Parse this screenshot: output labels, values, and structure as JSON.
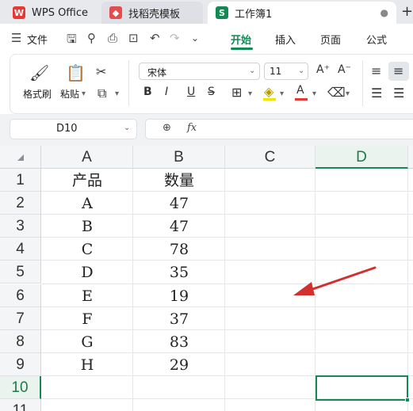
{
  "tabs": {
    "app": "WPS Office",
    "templates": "找稻壳模板",
    "workbook": "工作簿1",
    "workbook_badge": "S",
    "new_tab": "+"
  },
  "menu": {
    "file": "文件",
    "home": "开始",
    "insert": "插入",
    "page": "页面",
    "formula": "公式"
  },
  "ribbon": {
    "format_painter": "格式刷",
    "paste": "粘贴",
    "font_name": "宋体",
    "font_size": "11"
  },
  "formula_bar": {
    "name_box": "D10",
    "fx_label": "fx",
    "content": ""
  },
  "grid": {
    "columns": [
      "A",
      "B",
      "C",
      "D"
    ],
    "rows": [
      "1",
      "2",
      "3",
      "4",
      "5",
      "6",
      "7",
      "8",
      "9",
      "10",
      "11"
    ],
    "active_cell": "D10",
    "cells": [
      [
        "产品",
        "数量"
      ],
      [
        "A",
        "47"
      ],
      [
        "B",
        "47"
      ],
      [
        "C",
        "78"
      ],
      [
        "D",
        "35"
      ],
      [
        "E",
        "19"
      ],
      [
        "F",
        "37"
      ],
      [
        "G",
        "83"
      ],
      [
        "H",
        "29"
      ]
    ]
  },
  "colors": {
    "accent": "#138a55",
    "annotation_arrow": "#d32f2f"
  }
}
